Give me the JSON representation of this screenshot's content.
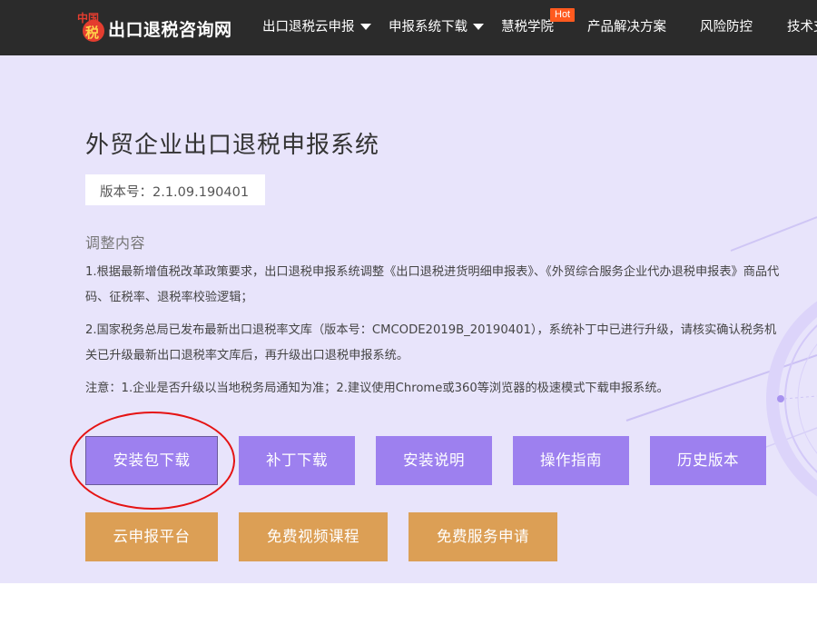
{
  "brand": {
    "logo_mark_line1": "中国",
    "logo_mark_line2": "税",
    "name": "出口退税咨询网"
  },
  "nav": {
    "items": [
      {
        "label": "出口退税云申报",
        "has_dropdown": true
      },
      {
        "label": "申报系统下载",
        "has_dropdown": true
      },
      {
        "label": "慧税学院",
        "badge": "Hot"
      },
      {
        "label": "产品解决方案"
      },
      {
        "label": "风险防控"
      },
      {
        "label": "技术支持"
      }
    ]
  },
  "hero": {
    "title": "外贸企业出口退税申报系统",
    "version_label": "版本号：2.1.09.190401",
    "section_heading": "调整内容",
    "paragraphs": [
      "1.根据最新增值税改革政策要求，出口退税申报系统调整《出口退税进货明细申报表》、《外贸综合服务企业代办退税申报表》商品代码、征税率、退税率校验逻辑；",
      "2.国家税务总局已发布最新出口退税率文库（版本号：CMCODE2019B_20190401），系统补丁中已进行升级，请核实确认税务机关已升级最新出口退税率文库后，再升级出口退税申报系统。",
      "注意：1.企业是否升级以当地税务局通知为准；2.建议使用Chrome或360等浏览器的极速模式下载申报系统。"
    ]
  },
  "buttons": {
    "row1": [
      "安装包下载",
      "补丁下载",
      "安装说明",
      "操作指南",
      "历史版本"
    ],
    "row2": [
      "云申报平台",
      "免费视频课程",
      "免费服务申请"
    ]
  },
  "colors": {
    "nav_bg": "#2b2b2b",
    "hero_bg": "#e8e4fb",
    "primary_button": "#9d80ef",
    "secondary_button": "#dc9f55",
    "hot_badge": "#ff5a1f",
    "highlight_circle": "#e51313"
  }
}
